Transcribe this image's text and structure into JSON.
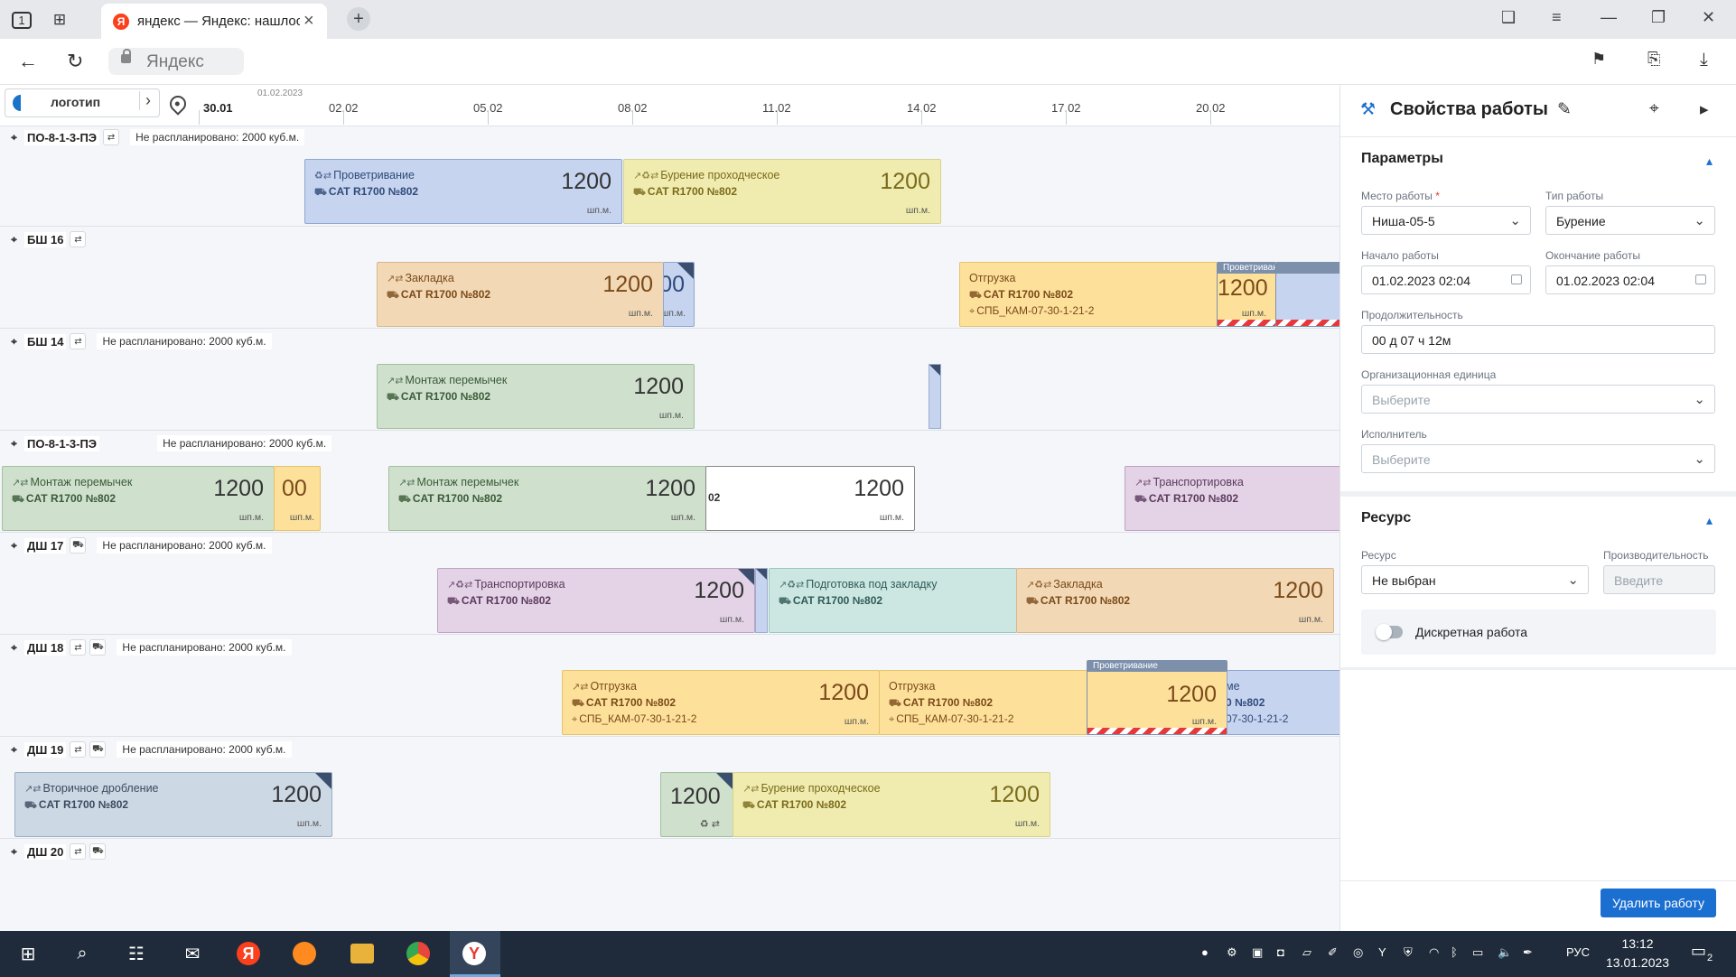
{
  "browser": {
    "tab_count": "1",
    "tab_title": "яндекс — Яндекс: нашлось",
    "address": "Яндекс"
  },
  "gantt": {
    "logo": "логотип",
    "year_label": "01.02.2023",
    "dates": [
      "30.01",
      "02.02",
      "05.02",
      "08.02",
      "11.02",
      "14.02",
      "17.02",
      "20.02"
    ],
    "rows": [
      {
        "name": "ПО-8-1-3-ПЭ",
        "note": "Не распланировано: 2000 куб.м."
      },
      {
        "name": "БШ 16",
        "note": ""
      },
      {
        "name": "БШ 14",
        "note": "Не распланировано: 2000 куб.м."
      },
      {
        "name": "ПО-8-1-3-ПЭ",
        "note": "Не распланировано: 2000 куб.м."
      },
      {
        "name": "ДШ 17",
        "note": "Не распланировано: 2000 куб.м."
      },
      {
        "name": "ДШ 18",
        "note": "Не распланировано: 2000 куб.м."
      },
      {
        "name": "ДШ 19",
        "note": "Не распланировано: 2000 куб.м."
      },
      {
        "name": "ДШ 20",
        "note": ""
      }
    ],
    "machine": "CAT R1700 №802",
    "unit": "шп.м.",
    "value": "1200",
    "ventilation_header": "Проветривание",
    "tasks": {
      "t1": "Проветривание",
      "t2": "Бурение проходческое",
      "t3": "Закладка",
      "t4": "Отгрузка",
      "t4_extra": "СПБ_КАМ-07-30-1-21-2",
      "t5": "Монтаж перемычек",
      "t6": "Монтаж перемычек",
      "t7": "Монтаж перемычек",
      "t8": "Транспортировка",
      "t9": "Транспортировка",
      "t10": "Подготовка под закладку",
      "t11": "Закладка",
      "t12": "Отгрузка",
      "t13": "Отгрузка",
      "t14": "Вторичное дробление",
      "t15": "Бурение проходческое",
      "partial_00": "00",
      "partial_02": "02",
      "partial_me": "ме",
      "partial_no802": "0 №802",
      "partial_code": "07-30-1-21-2"
    }
  },
  "panel": {
    "title": "Свойства работы",
    "section_params": "Параметры",
    "place_label": "Место работы",
    "place_required": "*",
    "place_value": "Ниша-05-5",
    "type_label": "Тип работы",
    "type_value": "Бурение",
    "start_label": "Начало работы",
    "start_value": "01.02.2023 02:04",
    "end_label": "Окончание работы",
    "end_value": "01.02.2023 02:04",
    "duration_label": "Продолжительность",
    "duration_value": "00 д 07 ч 12м",
    "org_label": "Организационная единица",
    "org_placeholder": "Выберите",
    "executor_label": "Исполнитель",
    "executor_placeholder": "Выберите",
    "section_resource": "Ресурс",
    "resource_label": "Ресурс",
    "resource_value": "Не выбран",
    "productivity_label": "Производительность",
    "productivity_placeholder": "Введите",
    "discrete_label": "Дискретная работа",
    "delete_button": "Удалить работу"
  },
  "taskbar": {
    "lang": "РУС",
    "time": "13:12",
    "date": "13.01.2023",
    "notifications": "2"
  },
  "colors": {
    "accent": "#1a6fd0",
    "ventilation_hatch": "#e5373c"
  }
}
